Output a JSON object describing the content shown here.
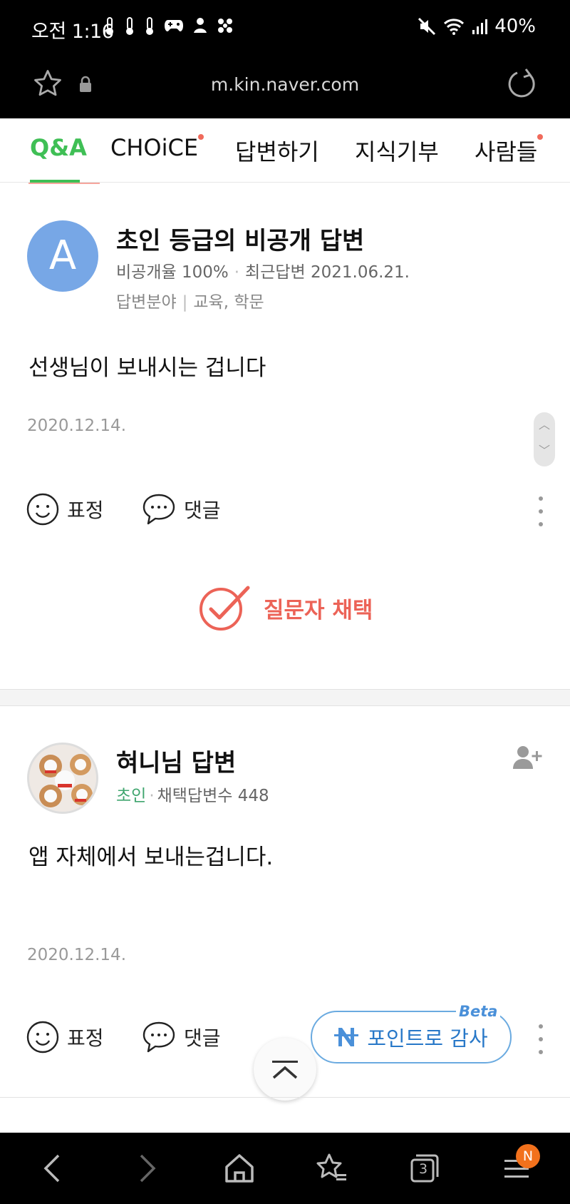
{
  "status_bar": {
    "time": "오전 1:16",
    "battery": "40%",
    "notification_icons": [
      "thermometer-icon",
      "thermometer-icon",
      "thermometer-icon",
      "gamepad-icon",
      "app-icon",
      "app-icon"
    ]
  },
  "browser": {
    "url": "m.kin.naver.com"
  },
  "tabs": [
    {
      "label": "Q&A",
      "active": true,
      "dot": false
    },
    {
      "label": "CHOiCE",
      "active": false,
      "dot": true
    },
    {
      "label": "답변하기",
      "active": false,
      "dot": false
    },
    {
      "label": "지식기부",
      "active": false,
      "dot": false
    },
    {
      "label": "사람들",
      "active": false,
      "dot": true
    }
  ],
  "answer1": {
    "avatar_letter": "A",
    "author": "초인 등급의 비공개 답변",
    "private_rate_label": "비공개율",
    "private_rate": "100%",
    "recent_label": "최근답변",
    "recent_date": "2021.06.21.",
    "field_label": "답변분야",
    "field": "교육, 학문",
    "content": "선생님이 보내시는 겁니다",
    "date": "2020.12.14.",
    "react_label": "표정",
    "comment_label": "댓글",
    "choose_label": "질문자 채택"
  },
  "answer2": {
    "author": "혀니님 답변",
    "grade": "초인",
    "adopted_label": "채택답변수",
    "adopted_count": "448",
    "content": "앱 자체에서 보내는겁니다.",
    "date": "2020.12.14.",
    "react_label": "표정",
    "comment_label": "댓글",
    "thanks_label": "포인트로 감사",
    "beta_label": "Beta"
  },
  "bottom_nav": {
    "tab_count": "3",
    "badge": "N"
  },
  "colors": {
    "accent_green": "#3fbf55",
    "choose_red": "#ec6357",
    "thanks_blue": "#2878c8",
    "avatar_blue": "#77a7e6"
  }
}
